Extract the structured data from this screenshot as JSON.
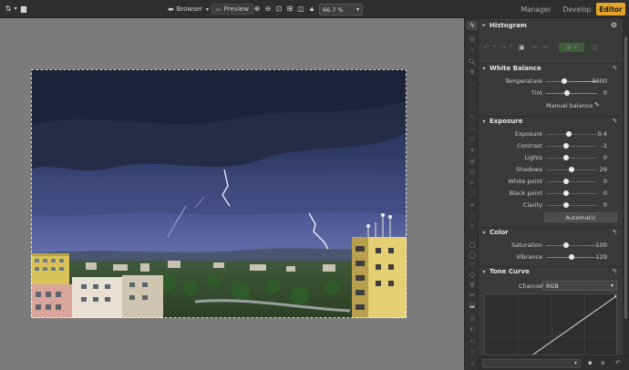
{
  "topbar": {
    "browser_label": "Browser",
    "preview_label": "Preview",
    "zoom_value": "66.7 %",
    "modes": [
      "Manager",
      "Develop",
      "Editor"
    ],
    "active_mode": "Editor",
    "accent_color": "#e4a526"
  },
  "panel": {
    "histogram_title": "Histogram",
    "white_balance": {
      "title": "White Balance",
      "temperature_label": "Temperature",
      "temperature_value": "5600",
      "tint_label": "Tint",
      "tint_value": "0",
      "manual_label": "Manual balance"
    },
    "exposure": {
      "title": "Exposure",
      "rows": [
        {
          "label": "Exposure",
          "value": "0.4"
        },
        {
          "label": "Contrast",
          "value": "-1"
        },
        {
          "label": "Lights",
          "value": "0"
        },
        {
          "label": "Shadows",
          "value": "29"
        },
        {
          "label": "White point",
          "value": "0"
        },
        {
          "label": "Black point",
          "value": "0"
        },
        {
          "label": "Clarity",
          "value": "0"
        }
      ],
      "automatic_label": "Automatic"
    },
    "color": {
      "title": "Color",
      "saturation_label": "Saturation",
      "saturation_value": "100",
      "vibrance_label": "Vibrance",
      "vibrance_value": "129"
    },
    "tone_curve": {
      "title": "Tone Curve",
      "channel_label": "Channel:",
      "channel_value": "RGB"
    }
  },
  "icons": {
    "sort": "sort-icon",
    "folder": "folder-icon",
    "lightning": "lightning-icon",
    "gear": "gear-icon",
    "reset": "reset-icon",
    "zoom_in": "zoom-in-icon",
    "zoom_out": "zoom-out-icon",
    "lock": "lock-icon",
    "eyedropper": "eyedropper-icon",
    "save": "save-icon",
    "undo": "undo-icon"
  }
}
